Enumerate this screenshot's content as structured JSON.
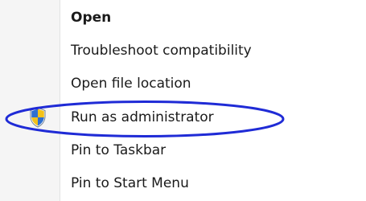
{
  "context_menu": {
    "items": [
      {
        "label": "Open",
        "bold": true
      },
      {
        "label": "Troubleshoot compatibility",
        "bold": false
      },
      {
        "label": "Open file location",
        "bold": false
      },
      {
        "label": "Run as administrator",
        "bold": false,
        "icon": "uac-shield-icon"
      },
      {
        "label": "Pin to Taskbar",
        "bold": false
      },
      {
        "label": "Pin to Start Menu",
        "bold": false
      }
    ],
    "highlighted_item": "Run as administrator",
    "highlight_color": "#1f2bd6"
  }
}
